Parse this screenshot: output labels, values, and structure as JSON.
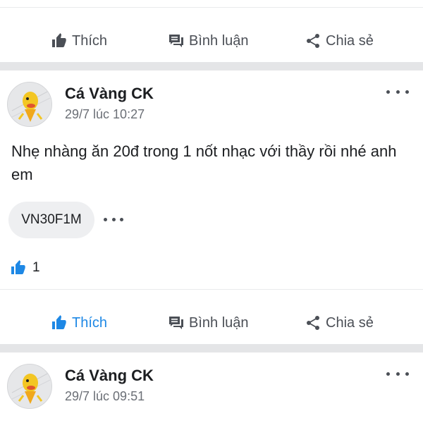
{
  "actions": {
    "like_label": "Thích",
    "comment_label": "Bình luận",
    "share_label": "Chia sẻ"
  },
  "posts": [
    {
      "author": "Cá Vàng CK",
      "timestamp": "29/7 lúc 10:27",
      "text": "Nhẹ nhàng ăn 20đ trong 1 nốt nhạc với thầy rồi nhé anh em",
      "tag": "VN30F1M",
      "like_count": "1",
      "liked": true
    },
    {
      "author": "Cá Vàng CK",
      "timestamp": "29/7 lúc 09:51"
    }
  ],
  "colors": {
    "accent": "#1e88e5",
    "icon_gray": "#4b4f56",
    "divider": "#e4e5e7",
    "timestamp": "#6b6f76"
  },
  "icons": [
    "thumbs-up-icon",
    "comment-icon",
    "share-icon",
    "more-icon"
  ]
}
